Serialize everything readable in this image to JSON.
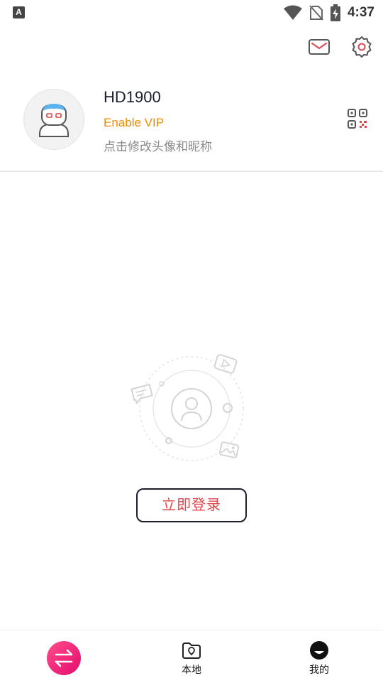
{
  "status_bar": {
    "app_icon": "A",
    "time": "4:37",
    "icons": [
      "wifi-icon",
      "no-sim-icon",
      "battery-charging-icon"
    ]
  },
  "header": {
    "icons": [
      "mail-icon",
      "settings-icon"
    ]
  },
  "profile": {
    "username": "HD1900",
    "vip_text": "Enable VIP",
    "hint": "点击修改头像和昵称",
    "vip_color": "#f08a00"
  },
  "main": {
    "login_button": "立即登录",
    "login_button_color": "#e0474c"
  },
  "bottom_nav": {
    "items": [
      {
        "label": "",
        "icon": "switch-arrows-icon"
      },
      {
        "label": "本地",
        "icon": "folder-icon"
      },
      {
        "label": "我的",
        "icon": "user-face-icon"
      }
    ]
  }
}
